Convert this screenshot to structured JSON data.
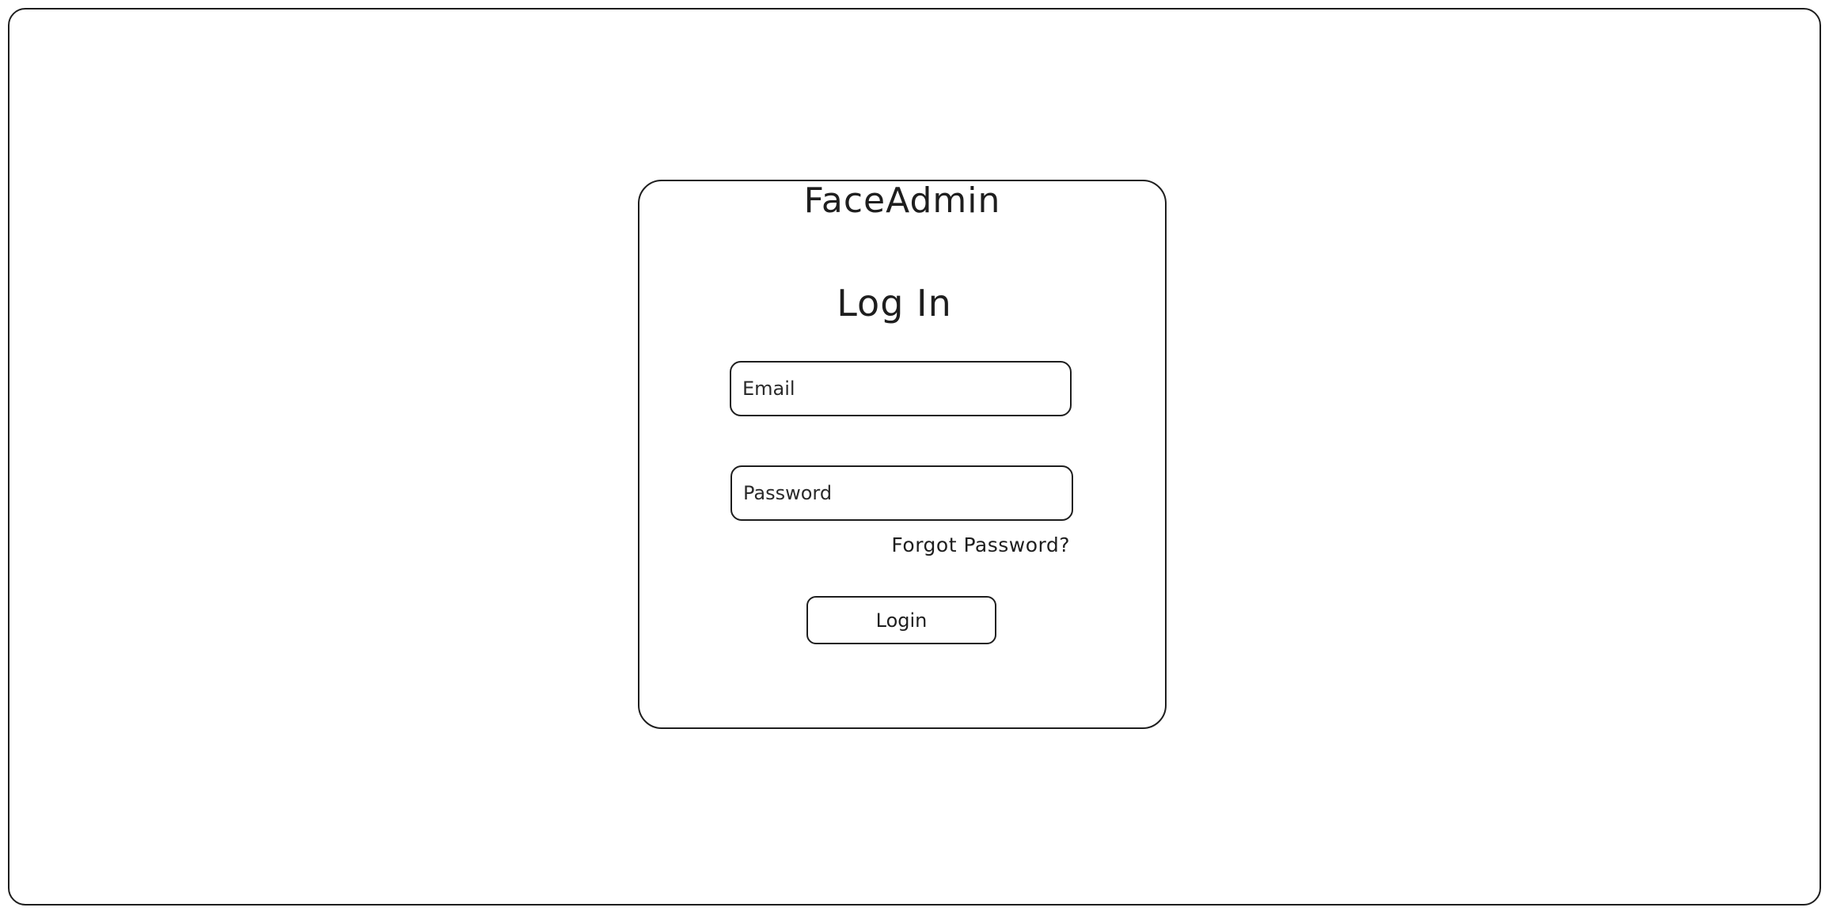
{
  "app": {
    "brand_name": "FaceAdmin"
  },
  "login_form": {
    "heading": "Log In",
    "email": {
      "value": "",
      "placeholder": "Email"
    },
    "password": {
      "value": "",
      "placeholder": "Password"
    },
    "forgot_password_label": "Forgot Password?",
    "login_button_label": "Login"
  },
  "colors": {
    "stroke": "#1e1e1e",
    "background": "#ffffff"
  }
}
